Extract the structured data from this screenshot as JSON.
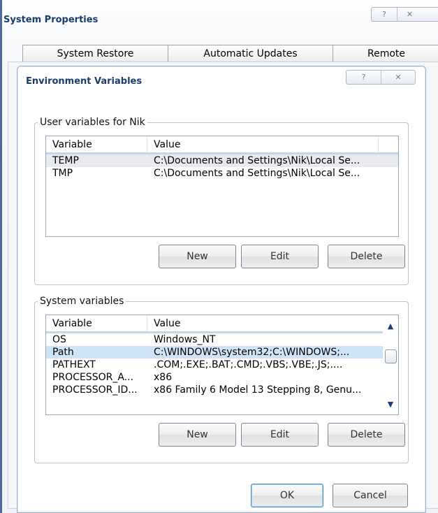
{
  "system_properties": {
    "title": "System Properties",
    "help_glyph": "?",
    "close_glyph": "✕",
    "tabs": [
      {
        "label": "System Restore"
      },
      {
        "label": "Automatic Updates"
      },
      {
        "label": "Remote"
      }
    ]
  },
  "env_dialog": {
    "title": "Environment Variables",
    "help_glyph": "?",
    "close_glyph": "✕",
    "user_group": {
      "legend": "User variables for Nik",
      "columns": {
        "variable": "Variable",
        "value": "Value"
      },
      "rows": [
        {
          "variable": "TEMP",
          "value": "C:\\Documents and Settings\\Nik\\Local Se..."
        },
        {
          "variable": "TMP",
          "value": "C:\\Documents and Settings\\Nik\\Local Se..."
        }
      ],
      "buttons": {
        "new": "New",
        "edit": "Edit",
        "delete": "Delete"
      }
    },
    "system_group": {
      "legend": "System variables",
      "columns": {
        "variable": "Variable",
        "value": "Value"
      },
      "rows": [
        {
          "variable": "OS",
          "value": "Windows_NT"
        },
        {
          "variable": "Path",
          "value": "C:\\WINDOWS\\system32;C:\\WINDOWS;..."
        },
        {
          "variable": "PATHEXT",
          "value": ".COM;.EXE;.BAT;.CMD;.VBS;.VBE;.JS;...."
        },
        {
          "variable": "PROCESSOR_A...",
          "value": "x86"
        },
        {
          "variable": "PROCESSOR_ID...",
          "value": "x86 Family 6 Model 13 Stepping 8, Genu..."
        }
      ],
      "selected_row": "Path",
      "buttons": {
        "new": "New",
        "edit": "Edit",
        "delete": "Delete"
      }
    },
    "footer": {
      "ok": "OK",
      "cancel": "Cancel"
    }
  },
  "icons": {
    "scroll_up": "scroll-up-arrow-icon",
    "scroll_down": "scroll-down-arrow-icon",
    "help": "help-icon",
    "close": "close-icon"
  },
  "colors": {
    "title_text": "#1a3c6e",
    "selection": "#cfe4f6",
    "hover_row": "#e8eaed",
    "header_underline": "#c2d6ec"
  }
}
